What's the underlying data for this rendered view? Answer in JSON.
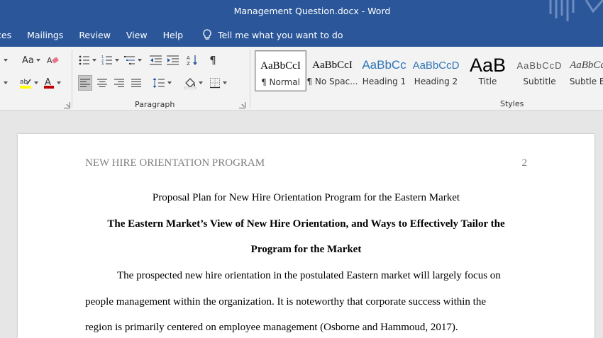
{
  "window": {
    "title": "Management Question.docx  -  Word"
  },
  "menu": {
    "items": [
      "ces",
      "Mailings",
      "Review",
      "View",
      "Help"
    ],
    "tell_me": "Tell me what you want to do"
  },
  "ribbon": {
    "groups": {
      "paragraph_label": "Paragraph",
      "styles_label": "Styles"
    },
    "font_size_sample": "Aa",
    "styles": [
      {
        "sample": "AaBbCcI",
        "name": "¶ Normal",
        "selected": true
      },
      {
        "sample": "AaBbCcI",
        "name": "¶ No Spac...",
        "selected": false
      },
      {
        "sample": "AaBbCc",
        "name": "Heading 1",
        "selected": false
      },
      {
        "sample": "AaBbCcD",
        "name": "Heading 2",
        "selected": false
      },
      {
        "sample": "AaB",
        "name": "Title",
        "selected": false
      },
      {
        "sample": "AaBbCcD",
        "name": "Subtitle",
        "selected": false
      },
      {
        "sample": "AaBbCcD",
        "name": "Subtle Em",
        "selected": false
      }
    ]
  },
  "document": {
    "running_head": "NEW HIRE ORIENTATION PROGRAM",
    "page_number": "2",
    "title_line": "Proposal Plan for New Hire Orientation Program for the Eastern Market",
    "heading_line1": "The Eastern Market’s View of New Hire Orientation, and Ways to Effectively Tailor the",
    "heading_line2": "Program for the Market",
    "body_lines": [
      "The prospected new hire orientation in the postulated Eastern market will largely focus on",
      "people management within the organization. It is noteworthy that corporate success within the",
      "region is primarily centered on employee management (Osborne and Hammoud, 2017)."
    ]
  },
  "colors": {
    "title_bar": "#2b579a",
    "ribbon_bg": "#f3f3f3",
    "doc_bg": "#e6e6e6",
    "heading1_blue": "#2e74b5",
    "font_color_red": "#c00000",
    "highlight_yellow": "#ffff00"
  }
}
